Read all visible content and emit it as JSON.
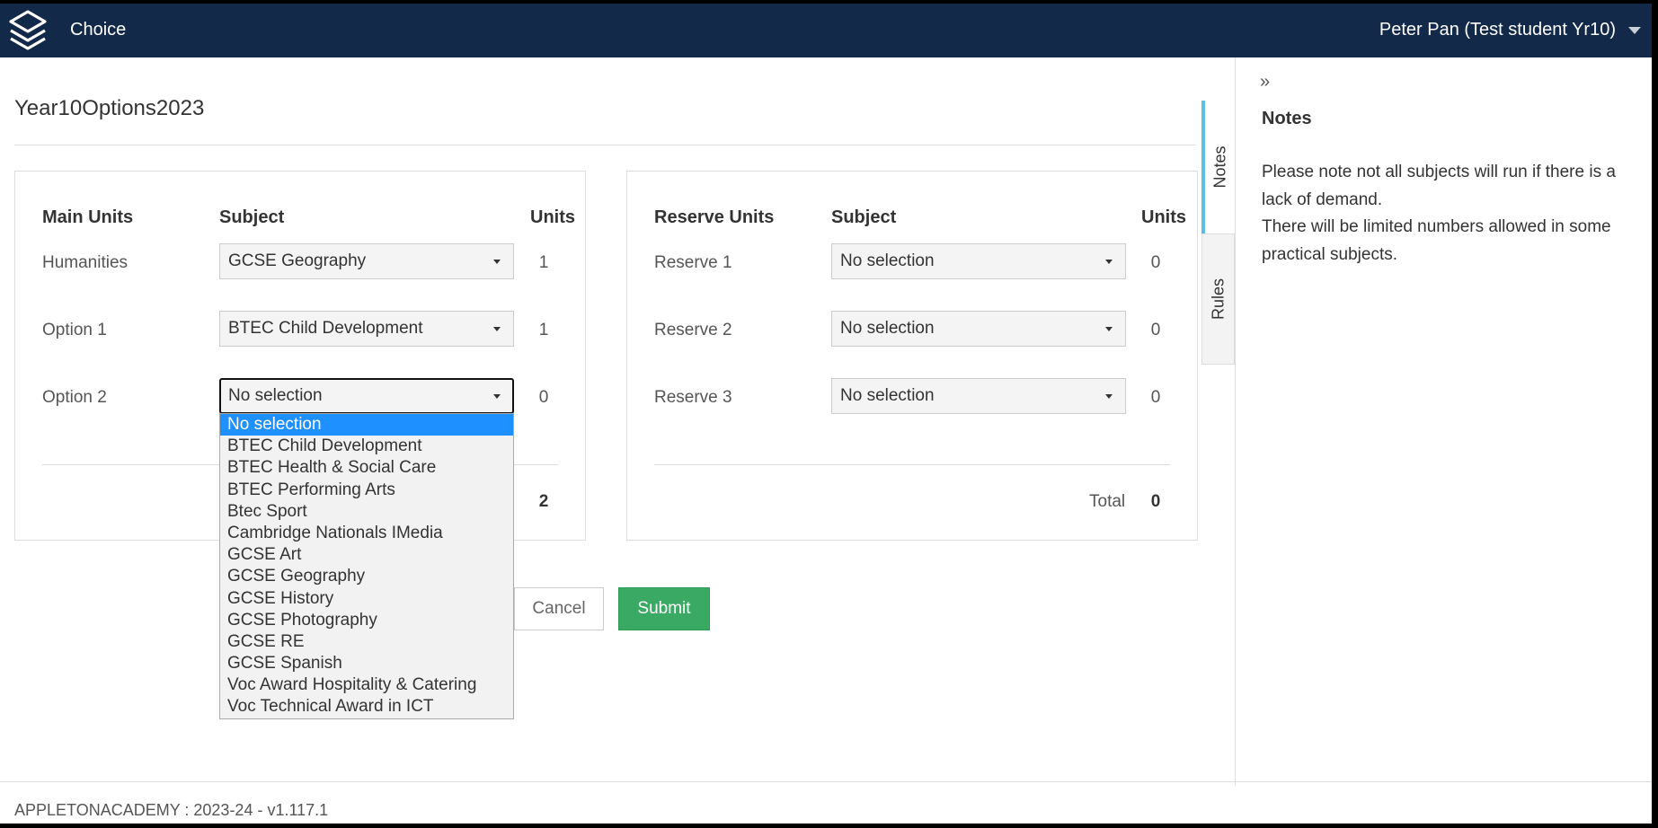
{
  "header": {
    "app_name": "Choice",
    "user_name": "Peter Pan (Test student Yr10)"
  },
  "page": {
    "title": "Year10Options2023"
  },
  "main_table": {
    "col_label": "Main Units",
    "col_subject": "Subject",
    "col_units": "Units",
    "rows": [
      {
        "label": "Humanities",
        "subject": "GCSE Geography",
        "units": "1"
      },
      {
        "label": "Option 1",
        "subject": "BTEC Child Development",
        "units": "1"
      },
      {
        "label": "Option 2",
        "subject": "No selection",
        "units": "0"
      }
    ],
    "total": "2"
  },
  "reserve_table": {
    "col_label": "Reserve Units",
    "col_subject": "Subject",
    "col_units": "Units",
    "rows": [
      {
        "label": "Reserve 1",
        "subject": "No selection",
        "units": "0"
      },
      {
        "label": "Reserve 2",
        "subject": "No selection",
        "units": "0"
      },
      {
        "label": "Reserve 3",
        "subject": "No selection",
        "units": "0"
      }
    ],
    "total_label": "Total",
    "total": "0"
  },
  "dropdown": {
    "selected_index": 0,
    "options": [
      "No selection",
      "BTEC Child Development",
      "BTEC Health & Social Care",
      "BTEC Performing Arts",
      "Btec Sport",
      "Cambridge Nationals IMedia",
      "GCSE Art",
      "GCSE Geography",
      "GCSE History",
      "GCSE Photography",
      "GCSE RE",
      "GCSE Spanish",
      "Voc Award Hospitality & Catering",
      "Voc Technical Award in ICT"
    ]
  },
  "buttons": {
    "cancel": "Cancel",
    "submit": "Submit"
  },
  "side_panel": {
    "collapse_glyph": "»",
    "tabs": [
      "Notes",
      "Rules"
    ],
    "active_tab": "Notes",
    "title": "Notes",
    "lines": [
      "Please note not all subjects will run if there is a lack of demand.",
      "There will be limited numbers allowed in some practical subjects."
    ]
  },
  "footer": {
    "text": "APPLETONACADEMY : 2023-24 - v1.117.1"
  },
  "colors": {
    "topbar": "#12294a",
    "submit": "#3aa964",
    "dropdown_highlight": "#1e90ff",
    "active_tab_accent": "#5bc0de"
  }
}
